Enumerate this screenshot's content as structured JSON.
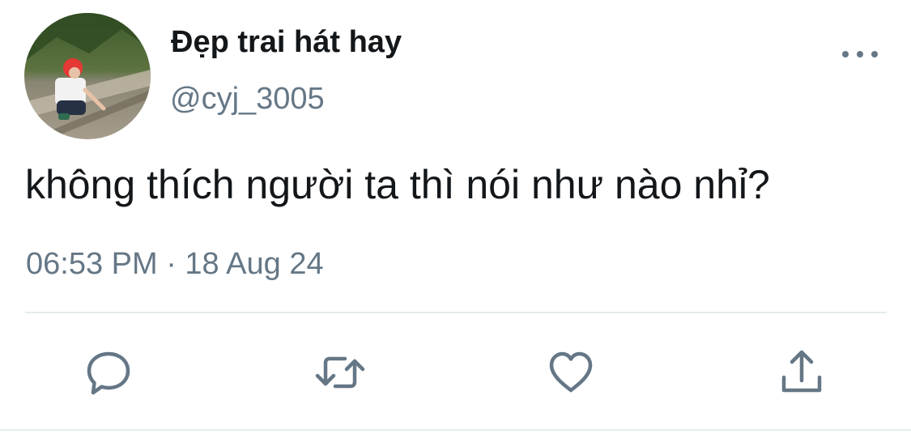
{
  "tweet": {
    "author": {
      "display_name": "Đẹp trai hát hay",
      "handle": "@cyj_3005",
      "avatar": "avatar-photo"
    },
    "text": "không thích người ta thì nói như nào nhỉ?",
    "timestamp": "06:53 PM · 18 Aug 24"
  },
  "icons": {
    "more": "more-horizontal-icon",
    "reply": "reply-bubble-icon",
    "retweet": "retweet-arrows-icon",
    "like": "heart-icon",
    "share": "share-upload-icon"
  },
  "colors": {
    "text_primary": "#14171a",
    "text_secondary": "#657786",
    "divider": "#e6ecf0"
  }
}
